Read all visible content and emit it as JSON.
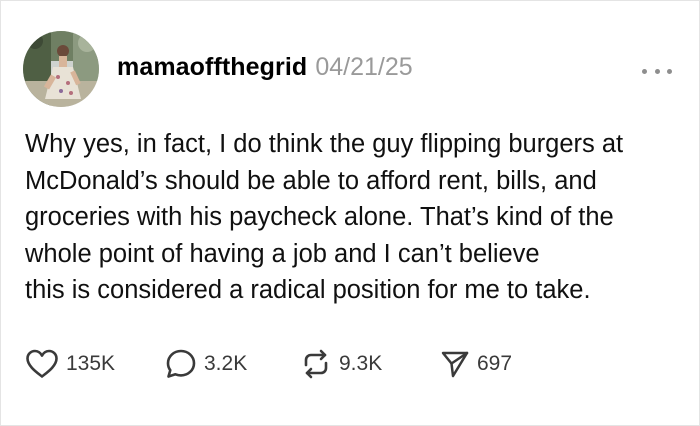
{
  "post": {
    "username": "mamaoffthegrid",
    "date": "04/21/25",
    "text_lines": [
      "Why yes, in fact, I do think the guy flipping burgers at",
      "McDonald’s should be able to afford rent, bills, and",
      "groceries with his paycheck alone. That’s kind of the",
      "whole point of having a job and I can’t believe",
      "this is considered a radical position for me to take."
    ]
  },
  "actions": {
    "likes": "135K",
    "replies": "3.2K",
    "reposts": "9.3K",
    "shares": "697"
  },
  "icons": {
    "like": "heart-icon",
    "reply": "speech-bubble-icon",
    "repost": "repost-arrows-icon",
    "share": "paper-plane-icon",
    "more": "more-options-icon"
  },
  "colors": {
    "text": "#101010",
    "date": "#9a9a9a",
    "icon": "#3a3a3a"
  }
}
